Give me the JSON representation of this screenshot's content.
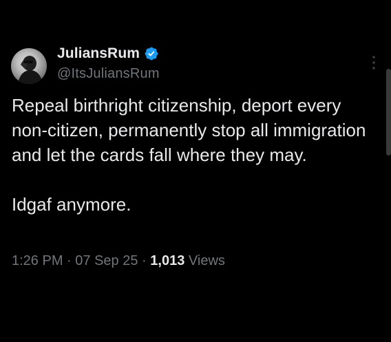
{
  "tweet": {
    "author": {
      "display_name": "JuliansRum",
      "handle": "@ItsJuliansRum",
      "verified": true
    },
    "text": [
      "Repeal birthright citizenship, deport every non-citizen, permanently stop all immigration and let the cards fall where they may.",
      "Idgaf anymore."
    ],
    "meta": {
      "time": "1:26 PM",
      "separator": "·",
      "date": "07 Sep 25",
      "views_count": "1,013",
      "views_label": "Views"
    }
  },
  "colors": {
    "background": "#000000",
    "primary_text": "#e7e9ea",
    "secondary_text": "#71767b",
    "verified_badge": "#1d9bf0"
  },
  "icons": {
    "verified": "verified-badge-icon",
    "more": "more-vertical-icon"
  }
}
